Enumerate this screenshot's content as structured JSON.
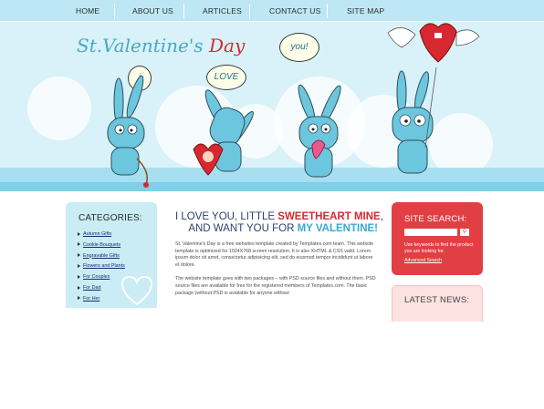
{
  "nav": {
    "items": [
      {
        "label": "HOME"
      },
      {
        "label": "ABOUT US"
      },
      {
        "label": "ARTICLES"
      },
      {
        "label": "CONTACT US"
      },
      {
        "label": "SITE MAP"
      }
    ]
  },
  "header": {
    "title_main": "St.Valentine's",
    "title_day": "Day",
    "bubbles": {
      "i": "i",
      "love": "LOVE",
      "you": "you!"
    }
  },
  "categories": {
    "heading": "CATEGORIES:",
    "items": [
      {
        "label": "Autumn Gifts"
      },
      {
        "label": "Cookie Bouquets"
      },
      {
        "label": "Engravable Gifts"
      },
      {
        "label": "Flowers and Plants"
      },
      {
        "label": "For Couples"
      },
      {
        "label": "For Dad"
      },
      {
        "label": "For Her"
      }
    ]
  },
  "main": {
    "title_line1_a": "I LOVE YOU, LITTLE ",
    "title_line1_b": "SWEETHEART MINE",
    "title_line1_c": ",",
    "title_line2_a": "AND WANT YOU FOR ",
    "title_line2_b": "MY VALENTINE!",
    "paragraph1": "St. Valentine's Day is a free websites template created by Templates.com team. This website template is optimized for 1024X768 screen resolution. It is also XHTML & CSS valid. Lorem ipsum dolor sit amet, consectetur adipisicing elit, sed do eiusmod tempor incididunt ut labore et dolore.",
    "paragraph2": "The website template goes with two packages – with PSD source files and without them. PSD source files are available for free for the registered members of Templates.com. The basic package (without PSD is available for anyone without"
  },
  "search": {
    "heading": "SITE SEARCH:",
    "input_value": "",
    "hint": "Use keywords to find the product you are looking for.",
    "advanced": "Advanced Search"
  },
  "news": {
    "heading": "LATEST NEWS:"
  },
  "colors": {
    "accent_red": "#d8282f",
    "accent_blue": "#39a9cc",
    "nav_bg": "#bde7f4"
  }
}
